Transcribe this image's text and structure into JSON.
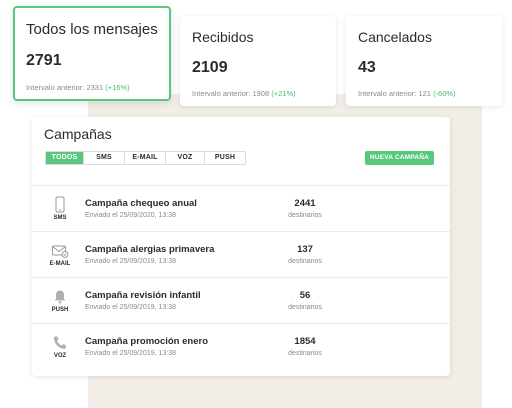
{
  "stats": [
    {
      "title": "Todos los mensajes",
      "value": "2791",
      "prev_label": "Intervalo anterior: 2331",
      "delta": "(+16%)"
    },
    {
      "title": "Recibidos",
      "value": "2109",
      "prev_label": "Intervalo anterior: 1908",
      "delta": "(+21%)"
    },
    {
      "title": "Cancelados",
      "value": "43",
      "prev_label": "Intervalo anterior: 121",
      "delta": "(-60%)"
    }
  ],
  "campaigns": {
    "title": "Campañas",
    "filters": [
      "TODOS",
      "SMS",
      "E-MAIL",
      "VOZ",
      "PUSH"
    ],
    "active_filter": "TODOS",
    "new_button": "NUEVA CAMPAÑA",
    "rows": [
      {
        "icon": "phone-icon",
        "type": "SMS",
        "name": "Campaña chequeo anual",
        "date": "Enviado el 25/09/2020, 13:38",
        "count": "2441",
        "unit": "destinarios"
      },
      {
        "icon": "email-icon",
        "type": "E-MAIL",
        "name": "Campaña alergias primavera",
        "date": "Enviado el 25/09/2019, 13:38",
        "count": "137",
        "unit": "destinarios"
      },
      {
        "icon": "bell-icon",
        "type": "PUSH",
        "name": "Campaña revisión infantil",
        "date": "Enviado el 25/09/2019, 13:38",
        "count": "56",
        "unit": "destinarios"
      },
      {
        "icon": "handset-icon",
        "type": "VOZ",
        "name": "Campaña promoción enero",
        "date": "Enviado el 25/09/2019, 13:38",
        "count": "1854",
        "unit": "destinarios"
      }
    ]
  },
  "colors": {
    "accent": "#58c87c",
    "background_panel": "#f2eee7"
  }
}
